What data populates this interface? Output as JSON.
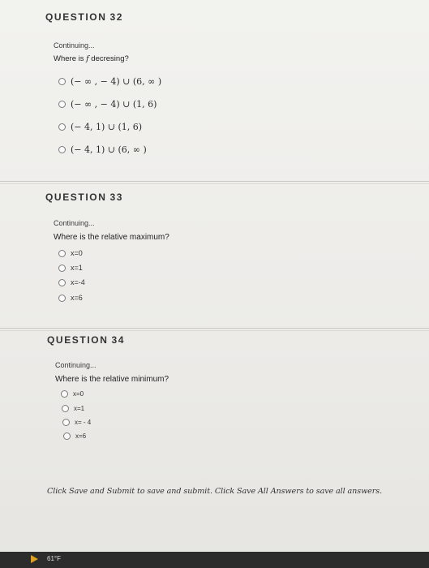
{
  "q32": {
    "title_word": "QUESTION",
    "number": "32",
    "continuing": "Continuing...",
    "prompt_a": "Where is",
    "prompt_f": "f",
    "prompt_b": "decresing?",
    "options": [
      "(− ∞ , − 4) ∪ (6,  ∞ )",
      "(− ∞ , − 4) ∪ (1, 6)",
      "(− 4, 1) ∪ (1, 6)",
      "(− 4, 1) ∪ (6,  ∞ )"
    ]
  },
  "q33": {
    "title_word": "QUESTION",
    "number": "33",
    "continuing": "Continuing...",
    "prompt": "Where is the relative maximum?",
    "options": [
      "x=0",
      "x=1",
      "x=-4",
      "x=6"
    ]
  },
  "q34": {
    "title_word": "QUESTION",
    "number": "34",
    "continuing": "Continuing...",
    "prompt": "Where is the relative minimum?",
    "options": [
      "x=0",
      "x=1",
      "x= - 4",
      "x=6"
    ]
  },
  "footer": {
    "note": "Click Save and Submit to save and submit. Click Save All Answers to save all answers."
  },
  "taskbar": {
    "temperature": "61°F"
  }
}
